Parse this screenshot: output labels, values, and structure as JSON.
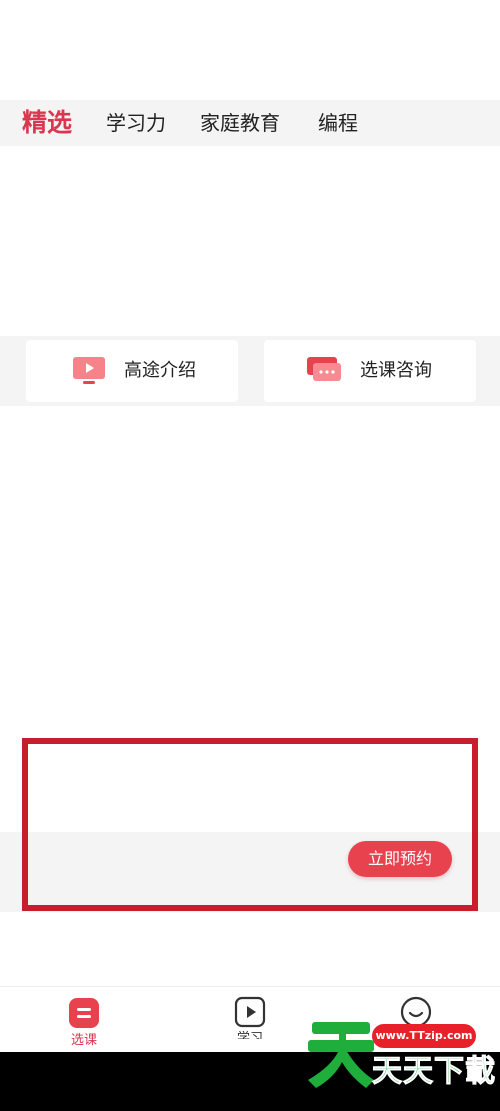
{
  "tabs": [
    {
      "label": "精选",
      "active": true
    },
    {
      "label": "学习力",
      "active": false
    },
    {
      "label": "家庭教育",
      "active": false
    },
    {
      "label": "编程",
      "active": false
    }
  ],
  "quick_links": [
    {
      "label": "高途介绍",
      "icon": "tv-icon"
    },
    {
      "label": "选课咨询",
      "icon": "chat-icon"
    }
  ],
  "promo": {
    "button_label": "立即预约"
  },
  "bottom_nav": [
    {
      "label": "选课",
      "icon": "course-list-icon",
      "active": true
    },
    {
      "label": "学习",
      "icon": "play-icon",
      "active": false
    },
    {
      "label": "",
      "icon": "smile-icon",
      "active": false
    }
  ],
  "watermark": {
    "url": "www.TTzip.com",
    "text": "天天下載"
  },
  "colors": {
    "accent": "#d8374f",
    "button": "#e8424f",
    "highlight_border": "#c81d2c",
    "band_bg": "#f4f4f4",
    "watermark_green": "#1fae3c"
  }
}
